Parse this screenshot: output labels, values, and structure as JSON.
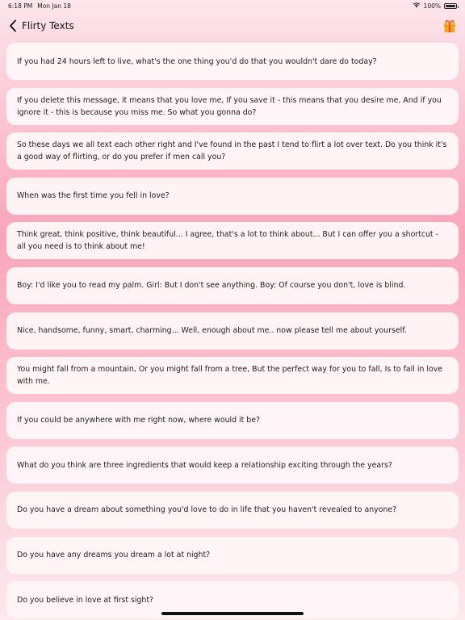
{
  "status_bar": {
    "time": "6:18 PM",
    "date": "Mon Jan 18",
    "battery": "100%",
    "battery_level": 1.0
  },
  "nav": {
    "title": "Flirty Texts"
  },
  "icons": {
    "back": "chevron-left-icon",
    "gift": "gift-icon",
    "wifi": "wifi-icon",
    "battery": "battery-icon"
  },
  "colors": {
    "gift_box": "#f4a31f",
    "gift_ribbon": "#e0501c",
    "card_background": "#fff6f8",
    "background_top": "#fde6ec",
    "background_mid": "#f9a4bb"
  },
  "messages": [
    "If you had 24 hours left to live, what's the one thing you'd do that you wouldn't dare do today?",
    "If you delete this message, it means that you love me, If you save it - this means that you desire me, And if you ignore it - this is because you miss me. So what you gonna do?",
    "So these days we all text each other right and I've found in the past I tend to flirt a lot over text. Do you think it's a good way of flirting, or do you prefer if men call you?",
    "When was the first time you fell in love?",
    "Think great, think positive, think beautiful... I agree, that's a lot to think about... But I can offer you a shortcut - all you need is to think about me!",
    "Boy: I'd like you to read my palm. Girl: But I don't see anything. Boy: Of course you don't, love is blind.",
    "Nice, handsome, funny, smart, charming... Well, enough about me.. now please tell me about yourself.",
    "You might fall from a mountain, Or you might fall from a tree, But the perfect way for you to fall, Is to fall in love with me.",
    "If you could be anywhere with me right now, where would it be?",
    "What do you think are three ingredients that would keep a relationship exciting through the years?",
    "Do you have a dream about something you'd love to do in life that you haven't revealed to anyone?",
    "Do you have any dreams you dream a lot at night?",
    "Do you believe in love at first sight?"
  ]
}
